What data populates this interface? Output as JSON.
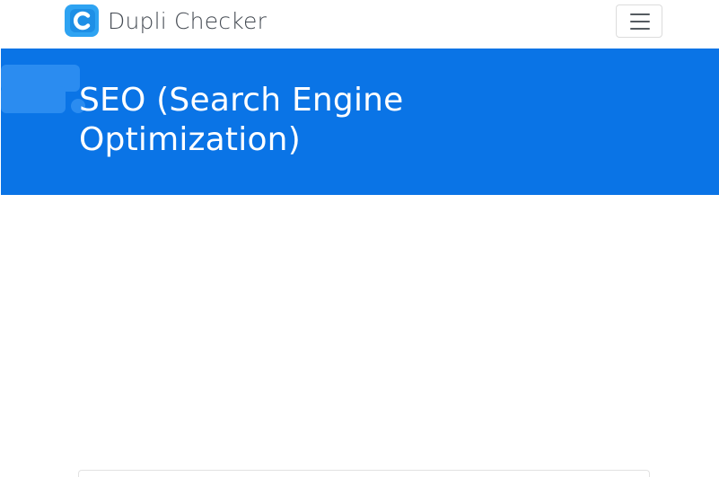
{
  "navbar": {
    "brand_name": "Dupli Checker",
    "logo_icon": "duplichecker-logo-icon",
    "menu_icon": "hamburger-menu-icon"
  },
  "hero": {
    "title": "SEO (Search Engine Optimization)"
  },
  "colors": {
    "hero_background": "#0a74e6",
    "hero_text": "#ffffff",
    "logo_outer": "#2ea3f2",
    "logo_inner": "#1e8fe6",
    "brand_text": "#444a52"
  }
}
